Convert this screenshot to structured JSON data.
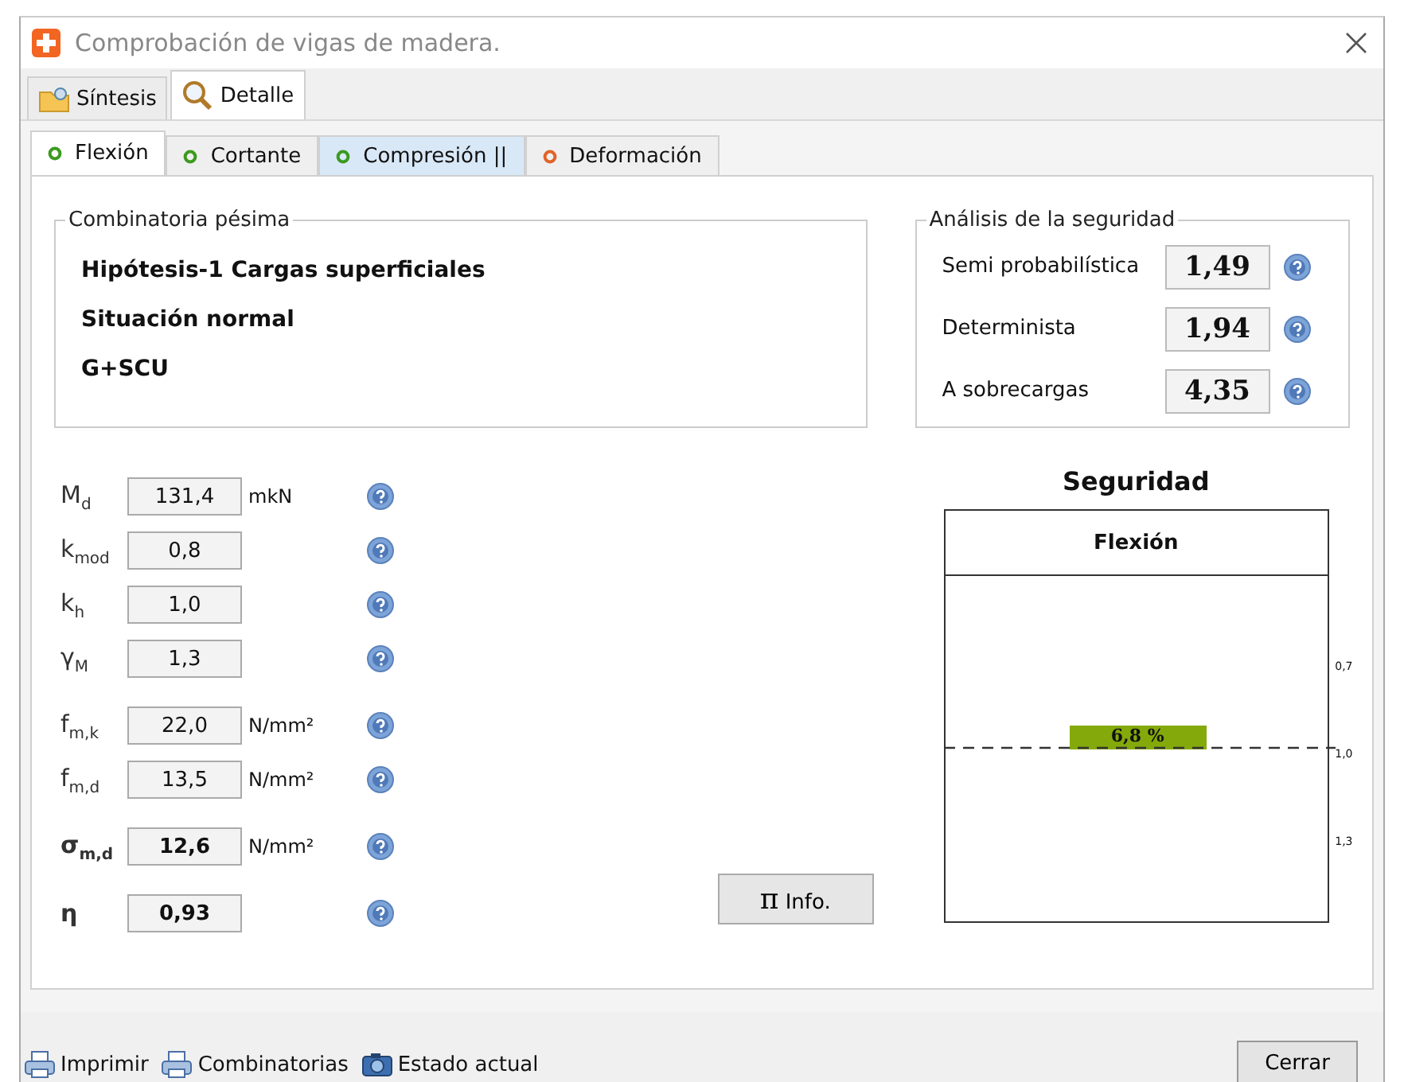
{
  "window": {
    "title": "Comprobación de vigas de madera."
  },
  "tabs": [
    {
      "label": "Síntesis",
      "kind": "folder",
      "selected": false
    },
    {
      "label": "Detalle",
      "kind": "magnifier",
      "selected": true
    }
  ],
  "subtabs": [
    {
      "label": "Flexión",
      "color": "#3c9a1e",
      "selected": true,
      "highlighted": false
    },
    {
      "label": "Cortante",
      "color": "#3c9a1e",
      "selected": false,
      "highlighted": false
    },
    {
      "label": "Compresión ||",
      "color": "#3c9a1e",
      "selected": false,
      "highlighted": true
    },
    {
      "label": "Deformación",
      "color": "#e0642a",
      "selected": false,
      "highlighted": false
    }
  ],
  "combination": {
    "title": "Combinatoria pésima",
    "lines": [
      "Hipótesis-1 Cargas superficiales",
      "Situación normal",
      "G+SCU"
    ]
  },
  "safety": {
    "title": "Análisis de la seguridad",
    "rows": [
      {
        "label": "Semi probabilística",
        "value": "1,49"
      },
      {
        "label": "Determinista",
        "value": "1,94"
      },
      {
        "label": "A sobrecargas",
        "value": "4,35"
      }
    ]
  },
  "parameters": [
    {
      "symbol": "M$_{d}$",
      "value": "131,4",
      "unit": "mkN",
      "bold": false,
      "gap": false
    },
    {
      "symbol": "k$_{mod}$",
      "value": "0,8",
      "bold": false,
      "gap": false
    },
    {
      "symbol": "k$_{h}$",
      "value": "1,0",
      "bold": false,
      "gap": false
    },
    {
      "symbol": "γ$_{M}$",
      "value": "1,3",
      "bold": false,
      "gap": false
    },
    {
      "symbol": "f$_{m,k}$",
      "value": "22,0",
      "unit": "N/mm²",
      "bold": false,
      "gap": true
    },
    {
      "symbol": "f$_{m,d}$",
      "value": "13,5",
      "unit": "N/mm²",
      "bold": false,
      "gap": false
    },
    {
      "symbol": "σ$_{m,d}$",
      "value": "12,6",
      "unit": "N/mm²",
      "bold": true,
      "gap": true
    },
    {
      "symbol": "η",
      "value": "0,93",
      "bold": true,
      "gap": true
    }
  ],
  "info_button": {
    "symbol": "π",
    "label": "Info."
  },
  "gauge": {
    "title": "Seguridad",
    "header": "Flexión",
    "ticks": [
      "0,7",
      "1,0",
      "1,3"
    ],
    "bar_label": "6,8 %"
  },
  "footer": {
    "links": [
      {
        "label": "Imprimir",
        "kind": "printer"
      },
      {
        "label": "Combinatorias",
        "kind": "printer"
      },
      {
        "label": "Estado actual",
        "kind": "camera"
      }
    ],
    "close": "Cerrar"
  }
}
